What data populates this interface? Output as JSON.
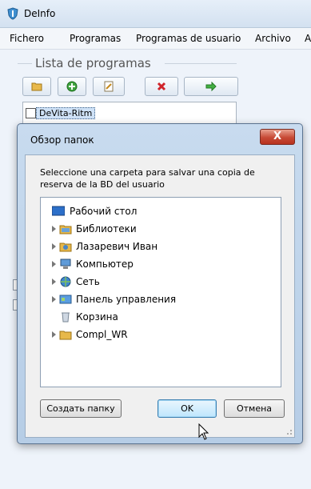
{
  "app": {
    "title": "DeInfo"
  },
  "menu": [
    "Fichero",
    "Programas",
    "Programas de usuario",
    "Archivo",
    "A"
  ],
  "panel": {
    "group_title": "Lista de programas",
    "program_item": "DeVita-Ritm"
  },
  "dialog": {
    "title": "Обзор папок",
    "close_label": "X",
    "message": "Seleccione una carpeta para salvar una copia de reserva de la BD del usuario",
    "tree": [
      {
        "label": "Рабочий стол",
        "icon": "desktop-icon"
      },
      {
        "label": "Библиотеки",
        "icon": "libraries-icon"
      },
      {
        "label": "Лазаревич Иван",
        "icon": "user-folder-icon"
      },
      {
        "label": "Компьютер",
        "icon": "computer-icon"
      },
      {
        "label": "Сеть",
        "icon": "network-icon"
      },
      {
        "label": "Панель управления",
        "icon": "control-panel-icon"
      },
      {
        "label": "Корзина",
        "icon": "recycle-bin-icon"
      },
      {
        "label": "Compl_WR",
        "icon": "folder-icon"
      }
    ],
    "buttons": {
      "new_folder": "Создать папку",
      "ok": "OK",
      "cancel": "Отмена"
    }
  }
}
